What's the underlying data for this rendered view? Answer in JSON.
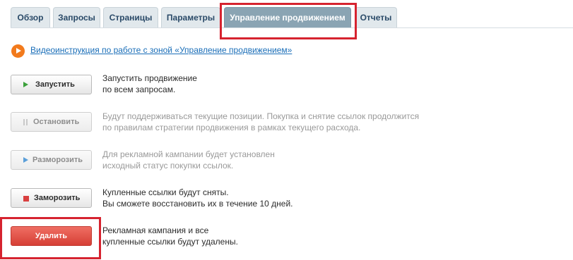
{
  "tabs": [
    {
      "label": "Обзор"
    },
    {
      "label": "Запросы"
    },
    {
      "label": "Страницы"
    },
    {
      "label": "Параметры"
    },
    {
      "label": "Управление продвижением"
    },
    {
      "label": "Отчеты"
    }
  ],
  "video_link": "Видеоинструкция по работе с зоной «Управление продвижением»",
  "actions": [
    {
      "label": "Запустить",
      "line1": "Запустить продвижение",
      "line2": "по всем запросам."
    },
    {
      "label": "Остановить",
      "line1": "Будут поддерживаться текущие позиции. Покупка и снятие ссылок продолжится",
      "line2": "по правилам стратегии продвижения в рамках текущего расхода."
    },
    {
      "label": "Разморозить",
      "line1": "Для рекламной кампании будет установлен",
      "line2": "исходный статус покупки ссылок."
    },
    {
      "label": "Заморозить",
      "line1": "Купленные ссылки будут сняты.",
      "line2": "Вы сможете восстановить их в течение 10 дней."
    },
    {
      "label": "Удалить",
      "line1": "Рекламная кампания и все",
      "line2": "купленные ссылки будут удалены."
    }
  ],
  "colors": {
    "highlight": "#d6232f",
    "active_tab": "#8aa4b3",
    "link": "#1a6eb8",
    "danger": "#d63f35"
  }
}
